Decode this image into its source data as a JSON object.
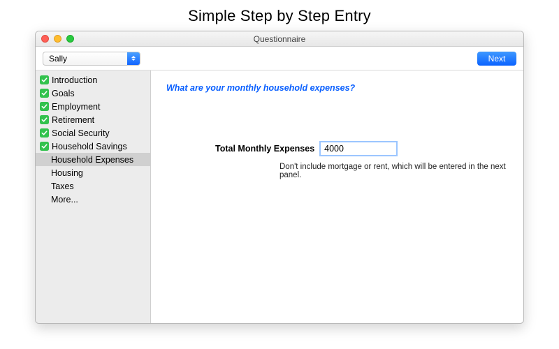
{
  "page_title": "Simple Step by Step Entry",
  "window_title": "Questionnaire",
  "toolbar": {
    "person_select": "Sally",
    "next_label": "Next"
  },
  "sidebar": {
    "items": [
      {
        "label": "Introduction",
        "checked": true,
        "child": false,
        "selected": false
      },
      {
        "label": "Goals",
        "checked": true,
        "child": false,
        "selected": false
      },
      {
        "label": "Employment",
        "checked": true,
        "child": false,
        "selected": false
      },
      {
        "label": "Retirement",
        "checked": true,
        "child": false,
        "selected": false
      },
      {
        "label": "Social Security",
        "checked": true,
        "child": false,
        "selected": false
      },
      {
        "label": "Household Savings",
        "checked": true,
        "child": false,
        "selected": false
      },
      {
        "label": "Household Expenses",
        "checked": false,
        "child": true,
        "selected": true
      },
      {
        "label": "Housing",
        "checked": false,
        "child": true,
        "selected": false
      },
      {
        "label": "Taxes",
        "checked": false,
        "child": true,
        "selected": false
      },
      {
        "label": "More...",
        "checked": false,
        "child": true,
        "selected": false
      }
    ]
  },
  "main": {
    "prompt": "What are your monthly household expenses?",
    "field_label": "Total Monthly Expenses",
    "field_value": "4000",
    "hint": "Don't include mortgage or rent, which will be entered in the next panel."
  }
}
